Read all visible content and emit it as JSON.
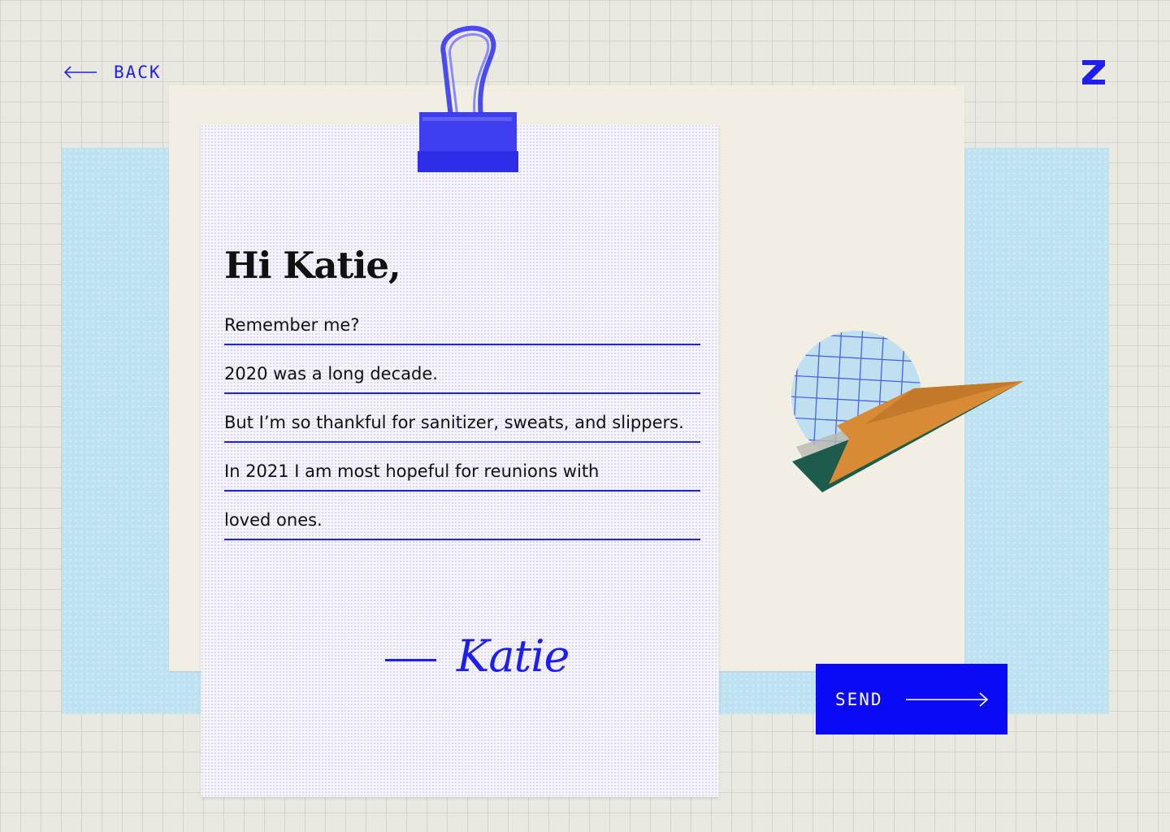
{
  "nav": {
    "back_label": "BACK",
    "back_icon": "arrow-left-icon",
    "logo_icon": "z-logo-icon"
  },
  "letter": {
    "greeting": "Hi Katie,",
    "lines": [
      "Remember me?",
      "2020 was a long decade.",
      "But I’m so thankful for sanitizer, sweats, and slippers.",
      "In 2021 I am most hopeful for reunions with",
      "loved ones."
    ],
    "signature": "Katie"
  },
  "actions": {
    "send_label": "SEND",
    "send_icon": "arrow-right-icon"
  },
  "colors": {
    "accent": "#1e1ef0",
    "button": "#0a0af5",
    "background": "#e9e9e2",
    "panel_blue": "#bfe2f0",
    "card_cream": "#f1eee4",
    "paper": "#f5f4f8",
    "plane_green": "#1d5c4b",
    "plane_orange": "#d98a35"
  }
}
